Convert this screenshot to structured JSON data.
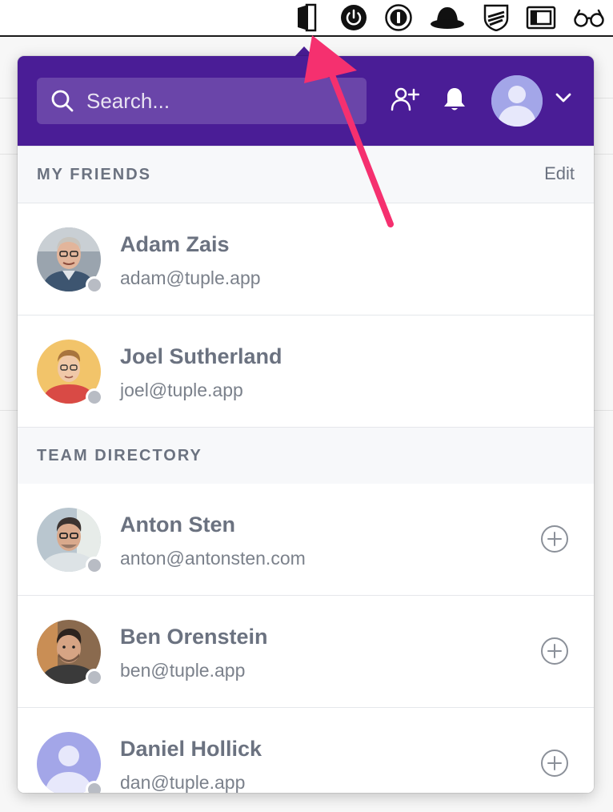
{
  "menubar": {
    "icons": [
      "tuple-door-icon",
      "power-icon",
      "onepassword-icon",
      "bowler-hat-icon",
      "shield-icon",
      "window-icon",
      "glasses-icon"
    ]
  },
  "header": {
    "search_placeholder": "Search...",
    "icons": [
      "search-icon",
      "add-friend-icon",
      "bell-icon",
      "user-avatar",
      "chevron-down-icon"
    ]
  },
  "friends": {
    "title": "MY FRIENDS",
    "action": "Edit",
    "items": [
      {
        "name": "Adam Zais",
        "email": "adam@tuple.app"
      },
      {
        "name": "Joel Sutherland",
        "email": "joel@tuple.app"
      }
    ]
  },
  "directory": {
    "title": "TEAM DIRECTORY",
    "items": [
      {
        "name": "Anton Sten",
        "email": "anton@antonsten.com"
      },
      {
        "name": "Ben Orenstein",
        "email": "ben@tuple.app"
      },
      {
        "name": "Daniel Hollick",
        "email": "dan@tuple.app"
      }
    ]
  },
  "colors": {
    "header_bg": "#4a1d96",
    "text_muted": "#6b7280",
    "section_bg": "#f7f8fa",
    "arrow": "#f5306f",
    "status_offline": "#b8bcc4"
  }
}
